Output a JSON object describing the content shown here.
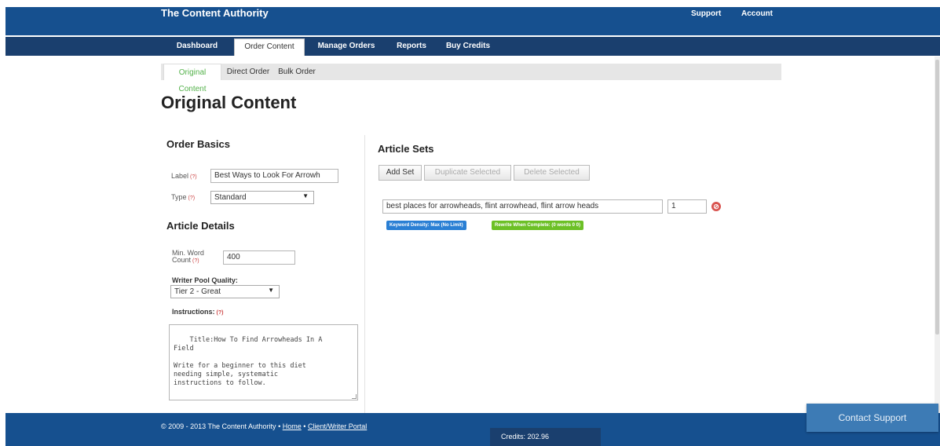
{
  "header": {
    "brand": "The Content Authority",
    "support_label": "Support",
    "account_label": "Account"
  },
  "nav": {
    "items": [
      {
        "label": "Dashboard"
      },
      {
        "label": "Order Content"
      },
      {
        "label": "Manage Orders"
      },
      {
        "label": "Reports"
      },
      {
        "label": "Buy Credits"
      }
    ],
    "active": "Order Content"
  },
  "subnav": {
    "items": [
      {
        "label": "Original Content"
      },
      {
        "label": "Direct Order"
      },
      {
        "label": "Bulk Order"
      }
    ],
    "active": "Original Content"
  },
  "page_title": "Original Content",
  "order_basics": {
    "heading": "Order Basics",
    "label_label": "Label",
    "label_value": "Best Ways to Look For Arrowh",
    "type_label": "Type",
    "type_value": "Standard",
    "help_marker": "(?)"
  },
  "article_details": {
    "heading": "Article Details",
    "min_word_label_line1": "Min. Word",
    "min_word_label_line2": "Count",
    "min_word_value": "400",
    "writer_pool_label": "Writer Pool Quality:",
    "writer_pool_value": "Tier 2 - Great",
    "instructions_label": "Instructions:",
    "instructions_value": "Title:How To Find Arrowheads In A\nField\n\nWrite for a beginner to this diet\nneeding simple, systematic\ninstructions to follow."
  },
  "article_sets": {
    "heading": "Article Sets",
    "add_set_label": "Add Set",
    "duplicate_label": "Duplicate Selected",
    "delete_label": "Delete Selected",
    "keywords_value": "best places for arrowheads, flint arrowhead, flint arrow heads",
    "quantity_value": "1",
    "remove_glyph": "⊘",
    "tags": [
      {
        "text": "Keyword Density: Max (No Limit)",
        "color": "#2a7fd4"
      },
      {
        "text": "Rewrite When Complete: (0 words 0 0)",
        "color": "#6cc026"
      }
    ]
  },
  "footer": {
    "copyright_text": "© 2009 - 2013 The Content Authority •",
    "home_link": "Home",
    "separator": "•",
    "portal_link": "Client/Writer Portal",
    "credits": "Credits: 202.96"
  },
  "contact_support_label": "Contact Support",
  "colors": {
    "header_blue": "#16508f",
    "nav_blue": "#1a3f6e",
    "active_green": "#54b24b"
  }
}
